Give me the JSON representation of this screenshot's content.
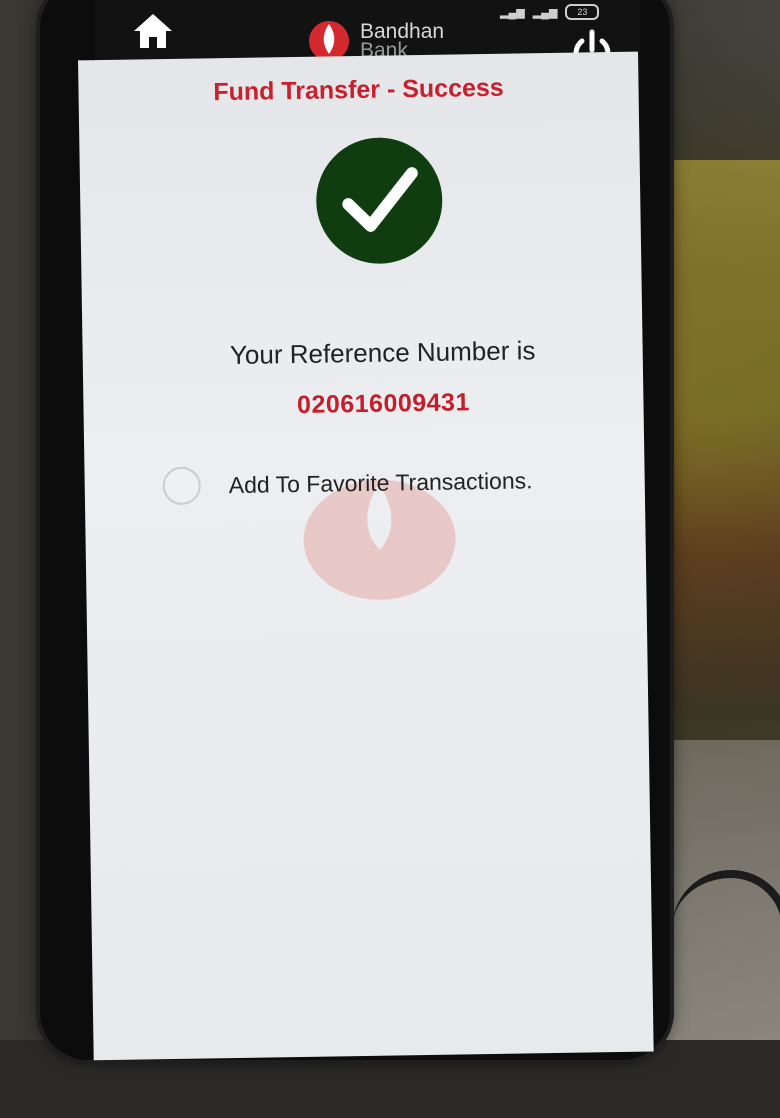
{
  "header": {
    "brand_line1": "Bandhan",
    "brand_line2": "Bank",
    "home_icon": "home-icon",
    "power_icon": "power-icon",
    "battery": "23"
  },
  "main": {
    "title": "Fund Transfer - Success",
    "success_icon": "checkmark-icon",
    "reference_label": "Your Reference Number is",
    "reference_number": "020616009431",
    "favorite_label": "Add To Favorite Transactions."
  },
  "colors": {
    "title_red": "#c8202c",
    "success_green": "#0f3d0f",
    "brand_red": "#d42a2f"
  }
}
